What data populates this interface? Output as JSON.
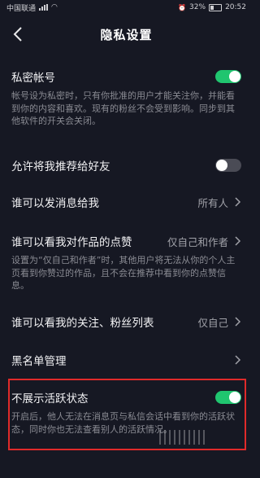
{
  "status_bar": {
    "carrier": "中国联通",
    "battery": "32%",
    "time": "20:52"
  },
  "header": {
    "title": "隐私设置",
    "back_icon": "back-arrow-icon"
  },
  "settings": {
    "private_account": {
      "label": "私密帐号",
      "description": "帐号设为私密时，只有你批准的用户才能关注你，并能看到你的内容和喜欢。现有的粉丝不会受到影响。同步到其他软件的开关会关闭。",
      "toggle": "on"
    },
    "recommend_to_friends": {
      "label": "允许将我推荐给好友",
      "toggle": "off"
    },
    "who_can_message": {
      "label": "谁可以发消息给我",
      "value": "所有人"
    },
    "who_can_see_likes": {
      "label": "谁可以看我对作品的点赞",
      "value": "仅自己和作者",
      "description": "设置为“仅自己和作者”时，其他用户将无法从你的个人主页看到你赞过的作品，且不会在推荐中看到你的点赞信息。"
    },
    "who_can_see_follows": {
      "label": "谁可以看我的关注、粉丝列表",
      "value": "仅自己"
    },
    "blacklist": {
      "label": "黑名单管理"
    },
    "hide_active_status": {
      "label": "不展示活跃状态",
      "description": "开启后，他人无法在消息页与私信会话中看到你的活跃状态，同时你也无法查看别人的活跃情况。",
      "toggle": "on"
    }
  },
  "colors": {
    "background": "#161823",
    "toggle_on": "#20c56f",
    "highlight_border": "#e02a2a"
  }
}
